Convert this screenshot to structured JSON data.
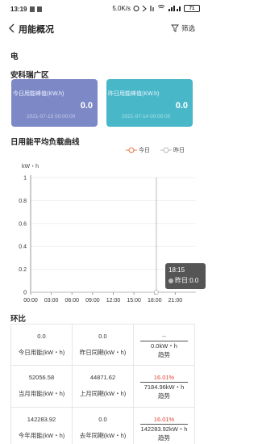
{
  "status_bar": {
    "time": "13:19",
    "network_speed": "5.0K/s",
    "battery": "71"
  },
  "header": {
    "title": "用能概况",
    "filter_label": "筛选"
  },
  "section_electric": "电",
  "site_name": "安科瑞广区",
  "cards": {
    "today": {
      "label": "今日用能峰值(KW.h)",
      "value": "0.0",
      "date": "2021-07-15 00:00:00",
      "color": "#7d89c7"
    },
    "yesterday": {
      "label": "昨日用能峰值(KW.h)",
      "value": "0.0",
      "date": "2021-07-14 00:00:00",
      "color": "#48b8c8"
    }
  },
  "chart_section_title": "日用能平均负载曲线",
  "chart_data": {
    "type": "line",
    "ylabel": "kW・h",
    "ylim": [
      0,
      1
    ],
    "y_ticks": [
      "0",
      "0.2",
      "0.4",
      "0.6",
      "0.8",
      "1"
    ],
    "x_ticks": [
      "00:00",
      "03:00",
      "06:00",
      "09:00",
      "12:00",
      "15:00",
      "18:00",
      "21:00"
    ],
    "legend": [
      {
        "name": "今日",
        "color": "#e8734a"
      },
      {
        "name": "昨日",
        "color": "#b8b8b8"
      }
    ],
    "tooltip": {
      "time": "18:15",
      "series": "昨日",
      "value": "0.0"
    }
  },
  "comparison_title": "环比",
  "comparison": {
    "today_usage": {
      "value": "0.0",
      "label": "今日用能(kW・h)"
    },
    "yesterday_same": {
      "value": "0.0",
      "label": "昨日同期(kW・h)"
    },
    "day_trend": {
      "percent": "--",
      "value": "0.0kW・h",
      "label": "趋势"
    },
    "month_usage": {
      "value": "52056.58",
      "label": "当月用能(kW・h)"
    },
    "last_month_same": {
      "value": "44871.62",
      "label": "上月同期(kW・h)"
    },
    "month_trend": {
      "percent": "16.01%",
      "value": "7184.96kW・h",
      "label": "趋势"
    },
    "year_usage": {
      "value": "142283.92",
      "label": "今年用能(kW・h)"
    },
    "last_year_same": {
      "value": "0.0",
      "label": "去年同期(kW・h)"
    },
    "year_trend": {
      "percent": "16.01%",
      "value": "142283.92kW・h",
      "label": "趋势"
    }
  }
}
